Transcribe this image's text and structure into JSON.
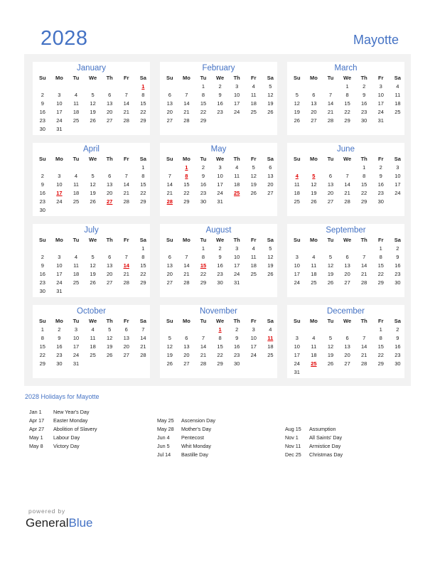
{
  "header": {
    "year": "2028",
    "country": "Mayotte"
  },
  "weekdays": [
    "Su",
    "Mo",
    "Tu",
    "We",
    "Th",
    "Fr",
    "Sa"
  ],
  "months": [
    {
      "name": "January",
      "start": 6,
      "days": 31,
      "holidays": [
        1
      ]
    },
    {
      "name": "February",
      "start": 2,
      "days": 29,
      "holidays": []
    },
    {
      "name": "March",
      "start": 3,
      "days": 31,
      "holidays": []
    },
    {
      "name": "April",
      "start": 6,
      "days": 30,
      "holidays": [
        17,
        27
      ]
    },
    {
      "name": "May",
      "start": 1,
      "days": 31,
      "holidays": [
        1,
        8,
        25,
        28
      ]
    },
    {
      "name": "June",
      "start": 4,
      "days": 30,
      "holidays": [
        4,
        5
      ]
    },
    {
      "name": "July",
      "start": 6,
      "days": 31,
      "holidays": [
        14
      ]
    },
    {
      "name": "August",
      "start": 2,
      "days": 31,
      "holidays": [
        15
      ]
    },
    {
      "name": "September",
      "start": 5,
      "days": 30,
      "holidays": []
    },
    {
      "name": "October",
      "start": 0,
      "days": 31,
      "holidays": []
    },
    {
      "name": "November",
      "start": 3,
      "days": 30,
      "holidays": [
        1,
        11
      ]
    },
    {
      "name": "December",
      "start": 5,
      "days": 31,
      "holidays": [
        25
      ]
    }
  ],
  "holidays_section": {
    "title": "2028 Holidays for Mayotte",
    "columns": [
      [
        {
          "date": "Jan 1",
          "name": "New Year's Day"
        },
        {
          "date": "Apr 17",
          "name": "Easter Monday"
        },
        {
          "date": "Apr 27",
          "name": "Abolition of Slavery"
        },
        {
          "date": "May 1",
          "name": "Labour Day"
        },
        {
          "date": "May 8",
          "name": "Victory Day"
        }
      ],
      [
        {
          "date": "May 25",
          "name": "Ascension Day"
        },
        {
          "date": "May 28",
          "name": "Mother's Day"
        },
        {
          "date": "Jun 4",
          "name": "Pentecost"
        },
        {
          "date": "Jun 5",
          "name": "Whit Monday"
        },
        {
          "date": "Jul 14",
          "name": "Bastille Day"
        }
      ],
      [
        {
          "date": "Aug 15",
          "name": "Assumption"
        },
        {
          "date": "Nov 1",
          "name": "All Saints' Day"
        },
        {
          "date": "Nov 11",
          "name": "Armistice Day"
        },
        {
          "date": "Dec 25",
          "name": "Christmas Day"
        }
      ]
    ]
  },
  "footer": {
    "powered_by": "powered by",
    "brand_general": "General",
    "brand_blue": "Blue"
  },
  "colors": {
    "accent": "#4472c4",
    "holiday": "#e00000",
    "panel": "#f2f2f2"
  }
}
